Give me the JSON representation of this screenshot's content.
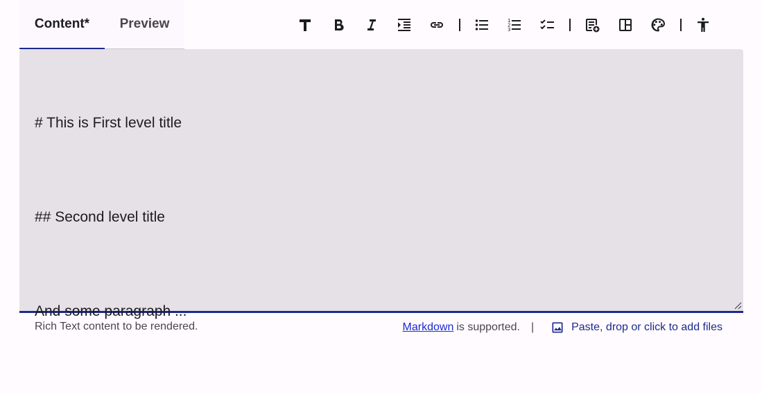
{
  "tabs": [
    {
      "label": "Content*",
      "active": true
    },
    {
      "label": "Preview",
      "active": false
    }
  ],
  "toolbar": {
    "icons": [
      "heading-icon",
      "bold-icon",
      "italic-icon",
      "indent-icon",
      "link-icon",
      "bullet-list-icon",
      "numbered-list-icon",
      "task-list-icon",
      "insert-block-icon",
      "columns-icon",
      "palette-icon",
      "accessibility-icon"
    ]
  },
  "editor": {
    "lines": [
      "# This is First level title",
      "## Second level title",
      "And some paragraph ..."
    ]
  },
  "footer": {
    "helper": "Rich Text content to be rendered.",
    "markdown_link": "Markdown",
    "supported": "is supported.",
    "separator": "|",
    "attach_label": "Paste, drop or click to add files"
  },
  "colors": {
    "accent": "#1b2a8c",
    "editor_bg": "#e6e1e7",
    "page_bg": "#fffbfe"
  }
}
